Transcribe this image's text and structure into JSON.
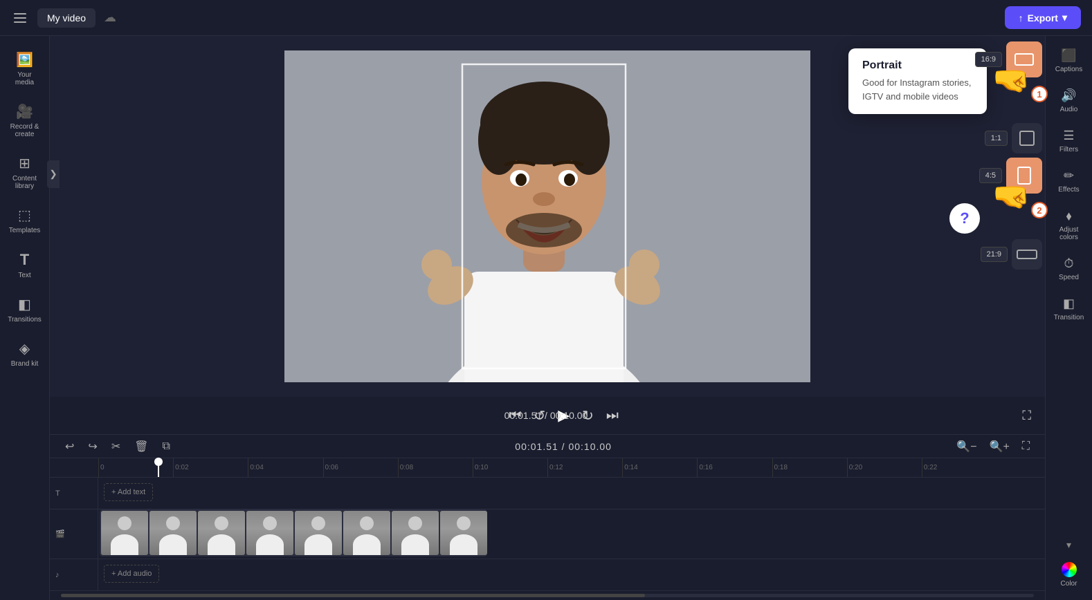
{
  "topbar": {
    "menu_label": "☰",
    "project_name": "My video",
    "cloud_icon": "☁",
    "export_label": "Export",
    "export_icon": "↑",
    "captions_label": "Captions"
  },
  "sidebar_left": {
    "items": [
      {
        "id": "your-media",
        "icon": "🖼",
        "label": "Your media"
      },
      {
        "id": "record-create",
        "icon": "🎥",
        "label": "Record &\ncreate"
      },
      {
        "id": "content-library",
        "icon": "⊞",
        "label": "Content\nlibrary"
      },
      {
        "id": "templates",
        "icon": "⬚",
        "label": "Templates"
      },
      {
        "id": "text",
        "icon": "T",
        "label": "Text"
      },
      {
        "id": "transitions",
        "icon": "◧",
        "label": "Transitions"
      },
      {
        "id": "brand-kit",
        "icon": "◈",
        "label": "Brand kit"
      }
    ]
  },
  "sidebar_right": {
    "items": [
      {
        "id": "captions",
        "icon": "⬛",
        "label": "Captions"
      },
      {
        "id": "audio",
        "icon": "🔊",
        "label": "Audio"
      },
      {
        "id": "filters",
        "icon": "☰",
        "label": "Filters"
      },
      {
        "id": "effects",
        "icon": "✏",
        "label": "Effects"
      },
      {
        "id": "adjust-colors",
        "icon": "⬧",
        "label": "Adjust\ncolors"
      },
      {
        "id": "speed",
        "icon": "⏱",
        "label": "Speed"
      },
      {
        "id": "transition",
        "icon": "◧",
        "label": "Transition"
      },
      {
        "id": "color",
        "icon": "●",
        "label": "Color"
      }
    ]
  },
  "portrait_tooltip": {
    "title": "Portrait",
    "description": "Good for Instagram stories, IGTV and mobile videos"
  },
  "aspect_ratios": [
    {
      "id": "16-9",
      "label": "16:9"
    },
    {
      "id": "1-1",
      "label": "1:1"
    },
    {
      "id": "4-5",
      "label": "4:5"
    },
    {
      "id": "21-9",
      "label": "21:9"
    }
  ],
  "playback": {
    "current_time": "00:01.51",
    "total_time": "00:10.00",
    "time_display": "00:01.51 / 00:10.00"
  },
  "timeline": {
    "ruler_marks": [
      "0",
      "0:02",
      "0:04",
      "0:06",
      "0:08",
      "0:10",
      "0:12",
      "0:14",
      "0:16",
      "0:18",
      "0:20",
      "0:22"
    ],
    "time_display": "00:01.51 / 00:10.00",
    "add_text_label": "+ Add text",
    "add_audio_label": "+ Add audio"
  },
  "cursor": {
    "hand_1_badge": "1",
    "hand_2_badge": "2"
  }
}
